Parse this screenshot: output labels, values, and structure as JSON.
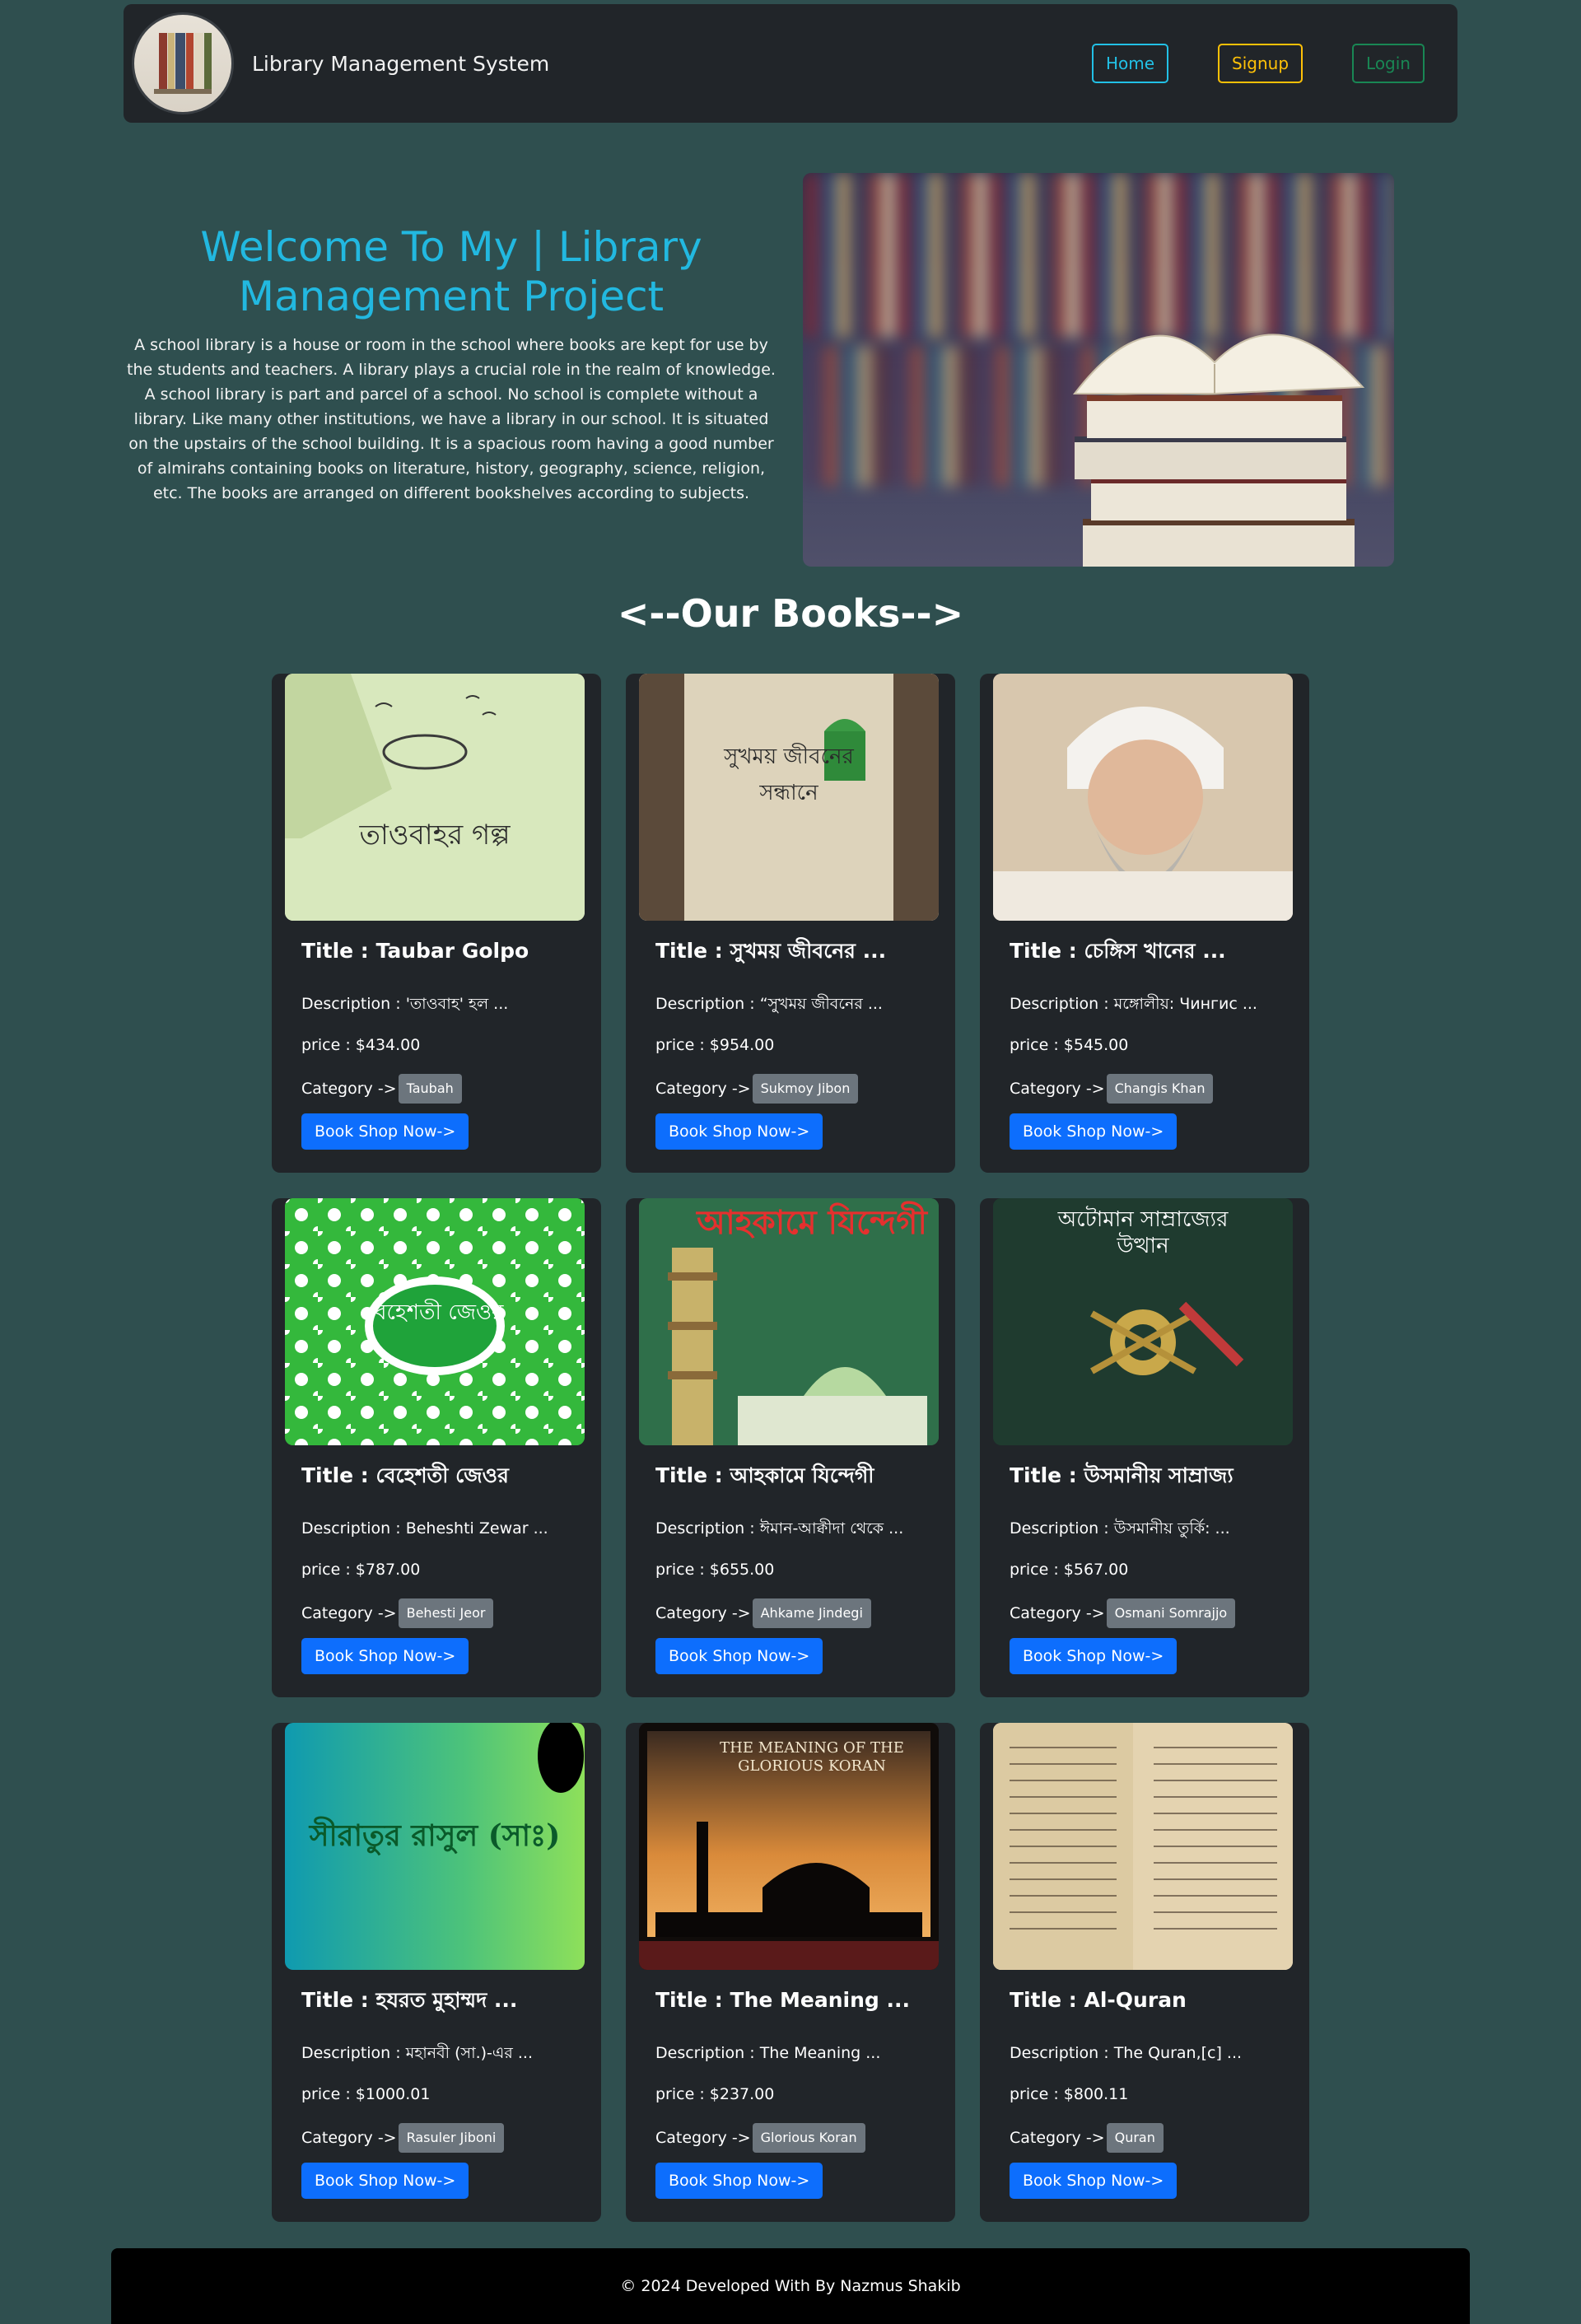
{
  "navbar": {
    "brand": "Library Management System",
    "home": "Home",
    "signup": "Signup",
    "login": "Login"
  },
  "hero": {
    "title": "Welcome To My | Library Management Project",
    "description": "A school library is a house or room in the school where books are kept for use by the students and teachers. A library plays a crucial role in the realm of knowledge. A school library is part and parcel of a school. No school is complete without a library. Like many other institutions, we have a library in our school. It is situated on the upstairs of the school building. It is a spacious room having a good number of almirahs containing books on literature, history, geography, science, religion, etc. The books are arranged on different bookshelves according to subjects."
  },
  "section_title": "<--Our Books-->",
  "card_labels": {
    "title_prefix": "Title : ",
    "description_prefix": "Description : ",
    "price_prefix": "price : ",
    "category_prefix": "Category ->",
    "button": "Book Shop Now->"
  },
  "books": [
    {
      "title": "Taubar Golpo",
      "description": "'তাওবাহ' হল ...",
      "price": "$434.00",
      "category": "Taubah",
      "cover_title": "তাওবাহর গল্প"
    },
    {
      "title": "সুখময় জীবনের ...",
      "description": "“সুখময় জীবনের ...",
      "price": "$954.00",
      "category": "Sukmoy Jibon",
      "cover_title": "সুখময় জীবনের সন্ধানে"
    },
    {
      "title": "চেঙ্গিস খানের ...",
      "description": "মঙ্গোলীয়: Чингис ...",
      "price": "$545.00",
      "category": "Changis Khan",
      "cover_title": ""
    },
    {
      "title": "বেহেশতী জেওর",
      "description": "Beheshti Zewar ...",
      "price": "$787.00",
      "category": "Behesti Jeor",
      "cover_title": "বেহেশতী জেওর"
    },
    {
      "title": "আহকামে যিন্দেগী",
      "description": "ঈমান-আক্বীদা থেকে ...",
      "price": "$655.00",
      "category": "Ahkame Jindegi",
      "cover_title": "আহকামে যিন্দেগী"
    },
    {
      "title": "উসমানীয় সাম্রাজ্য",
      "description": "উসমানীয় তুর্কি: ...",
      "price": "$567.00",
      "category": "Osmani Somrajjo",
      "cover_title": "অটোমান সাম্রাজ্যের উত্থান"
    },
    {
      "title": "হযরত মুহাম্মদ ...",
      "description": "মহানবী (সা.)-এর ...",
      "price": "$1000.01",
      "category": "Rasuler Jiboni",
      "cover_title": "সীরাতুর রাসুল (সাঃ)"
    },
    {
      "title": "The Meaning ...",
      "description": "The Meaning ...",
      "price": "$237.00",
      "category": "Glorious Koran",
      "cover_title": "THE MEANING OF THE GLORIOUS KORAN"
    },
    {
      "title": "Al-Quran",
      "description": "The Quran,[c] ...",
      "price": "$800.11",
      "category": "Quran",
      "cover_title": ""
    }
  ],
  "footer": {
    "text": "© 2024 Developed With By Nazmus Shakib"
  },
  "colors": {
    "page_bg": "#2f4f4f",
    "card_bg": "#212529",
    "accent_title": "#22b8e0",
    "primary_button": "#0d6efd",
    "badge": "#6c757d",
    "home": "#22c1e6",
    "signup": "#ffc107",
    "login": "#198754"
  }
}
